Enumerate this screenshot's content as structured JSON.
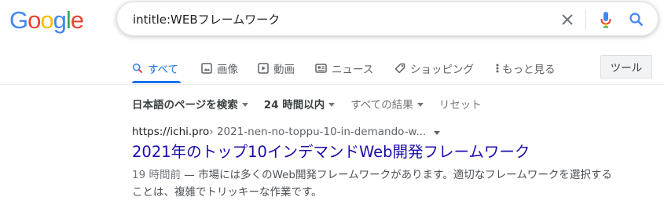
{
  "logo": {
    "letters": [
      "G",
      "o",
      "o",
      "g",
      "l",
      "e"
    ],
    "colors": [
      "#4285f4",
      "#ea4335",
      "#fbbc05",
      "#4285f4",
      "#34a853",
      "#ea4335"
    ]
  },
  "search": {
    "query": "intitle:WEBフレームワーク"
  },
  "tabs": [
    {
      "label": "すべて",
      "icon": "search-icon",
      "active": true
    },
    {
      "label": "画像",
      "icon": "image-icon"
    },
    {
      "label": "動画",
      "icon": "video-icon"
    },
    {
      "label": "ニュース",
      "icon": "news-icon"
    },
    {
      "label": "ショッピング",
      "icon": "tag-icon"
    },
    {
      "label": "もっと見る",
      "icon": "more-vert-icon"
    }
  ],
  "tools_label": "ツール",
  "filters": [
    {
      "label": "日本語のページを検索",
      "bold": true
    },
    {
      "label": "24 時間以内",
      "bold": true
    },
    {
      "label": "すべての結果",
      "bold": false
    },
    {
      "label": "リセット",
      "bold": false
    }
  ],
  "result": {
    "domain": "https://ichi.pro",
    "path": " › 2021-nen-no-toppu-10-in-demando-w...",
    "title": "2021年のトップ10インデマンドWeb開発フレームワーク",
    "date": "19 時間前",
    "snippet": " — 市場には多くのWeb開発フレームワークがあります。適切なフレームワークを選択することは、複雑でトリッキーな作業です。"
  },
  "colors": {
    "link": "#1a0dab",
    "accent": "#1a73e8"
  }
}
